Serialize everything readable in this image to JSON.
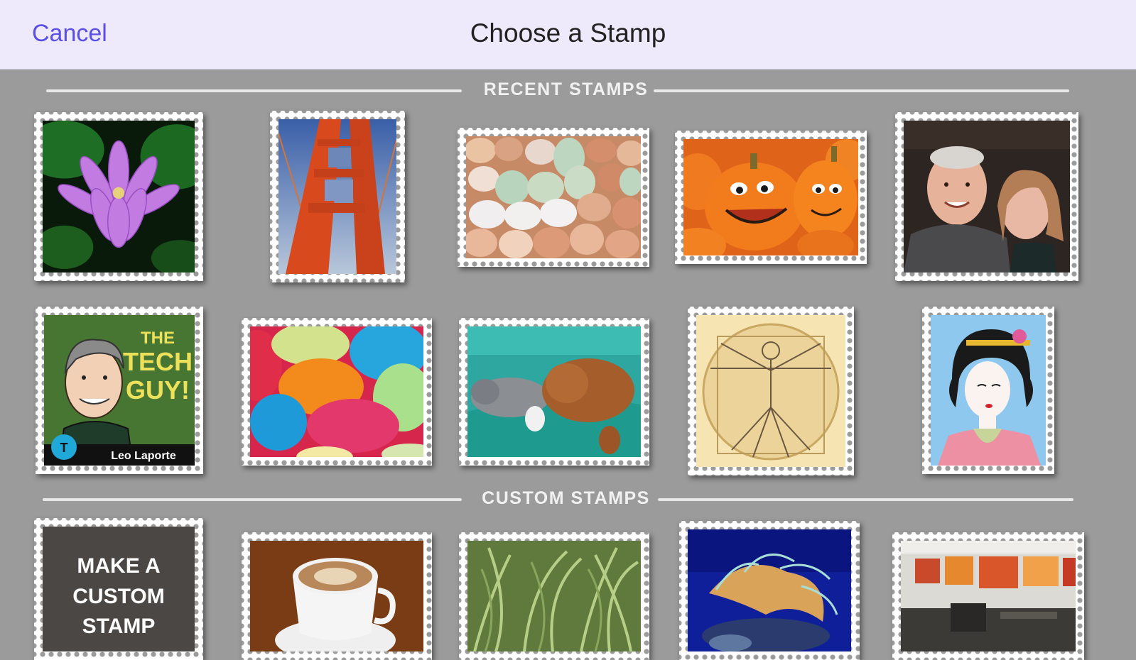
{
  "nav": {
    "cancel_label": "Cancel",
    "title": "Choose a Stamp"
  },
  "sections": {
    "recent": {
      "label": "RECENT STAMPS"
    },
    "custom": {
      "label": "CUSTOM STAMPS"
    }
  },
  "recent_stamps": [
    {
      "subject": "pink lotus flower"
    },
    {
      "subject": "golden gate bridge tower"
    },
    {
      "subject": "eggs"
    },
    {
      "subject": "jack-o-lantern pumpkins"
    },
    {
      "subject": "couple portrait"
    },
    {
      "subject": "the tech guy podcast art",
      "text_line1": "THE",
      "text_line2": "TECH",
      "text_line3": "GUY!",
      "caption": "Leo Laporte"
    },
    {
      "subject": "easter eggs"
    },
    {
      "subject": "dogs on sofa"
    },
    {
      "subject": "vitruvian man"
    },
    {
      "subject": "geisha illustration"
    }
  ],
  "custom_stamps": [
    {
      "subject": "make a custom stamp",
      "text_line1": "MAKE A",
      "text_line2": "CUSTOM",
      "text_line3": "STAMP"
    },
    {
      "subject": "cappuccino cup"
    },
    {
      "subject": "grass"
    },
    {
      "subject": "sea anemone"
    },
    {
      "subject": "art gallery room"
    }
  ],
  "colors": {
    "accent": "#5b4ee6",
    "navbar": "#eeeafc",
    "background": "#9b9b9b"
  }
}
